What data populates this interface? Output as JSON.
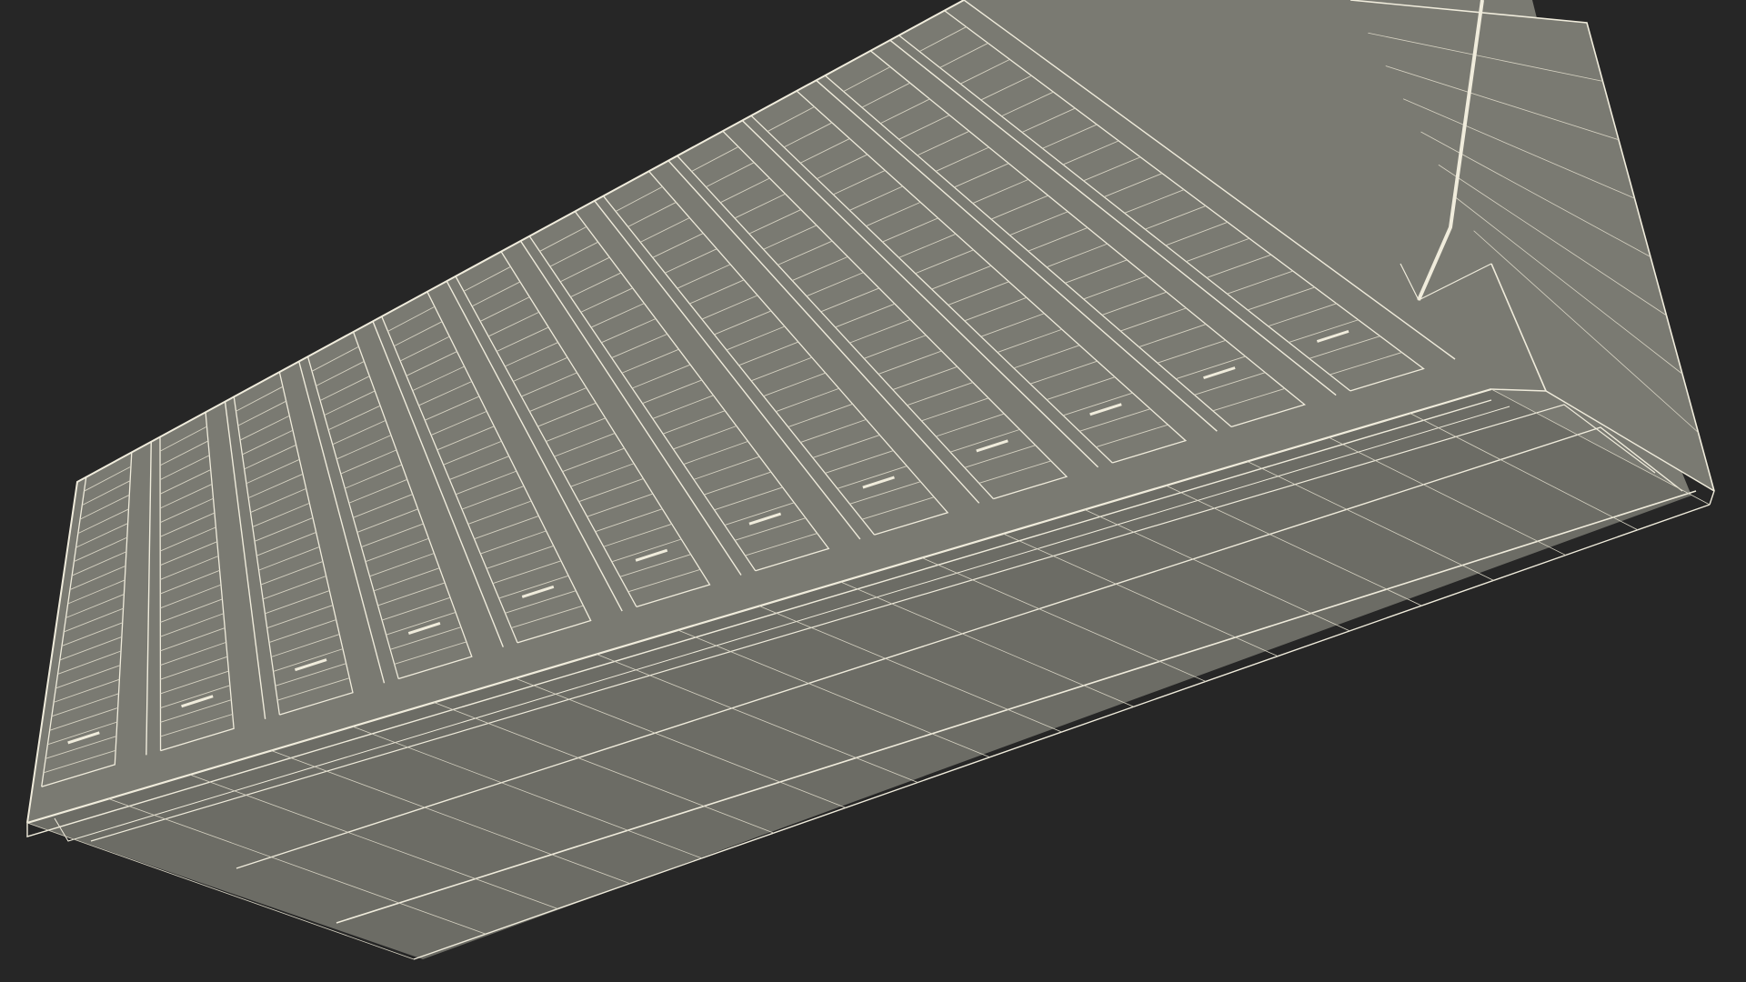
{
  "scene": {
    "background_color": "#262626",
    "surface_color": "#7a7a72",
    "surface_dark_color": "#6c6c65",
    "wire_color": "#f0ecdc",
    "wire_dim_color": "#d6d2c2"
  },
  "object": {
    "kind": "wireframe-container-module",
    "vent_panel_count": 12,
    "louver_slat_count": 22
  }
}
